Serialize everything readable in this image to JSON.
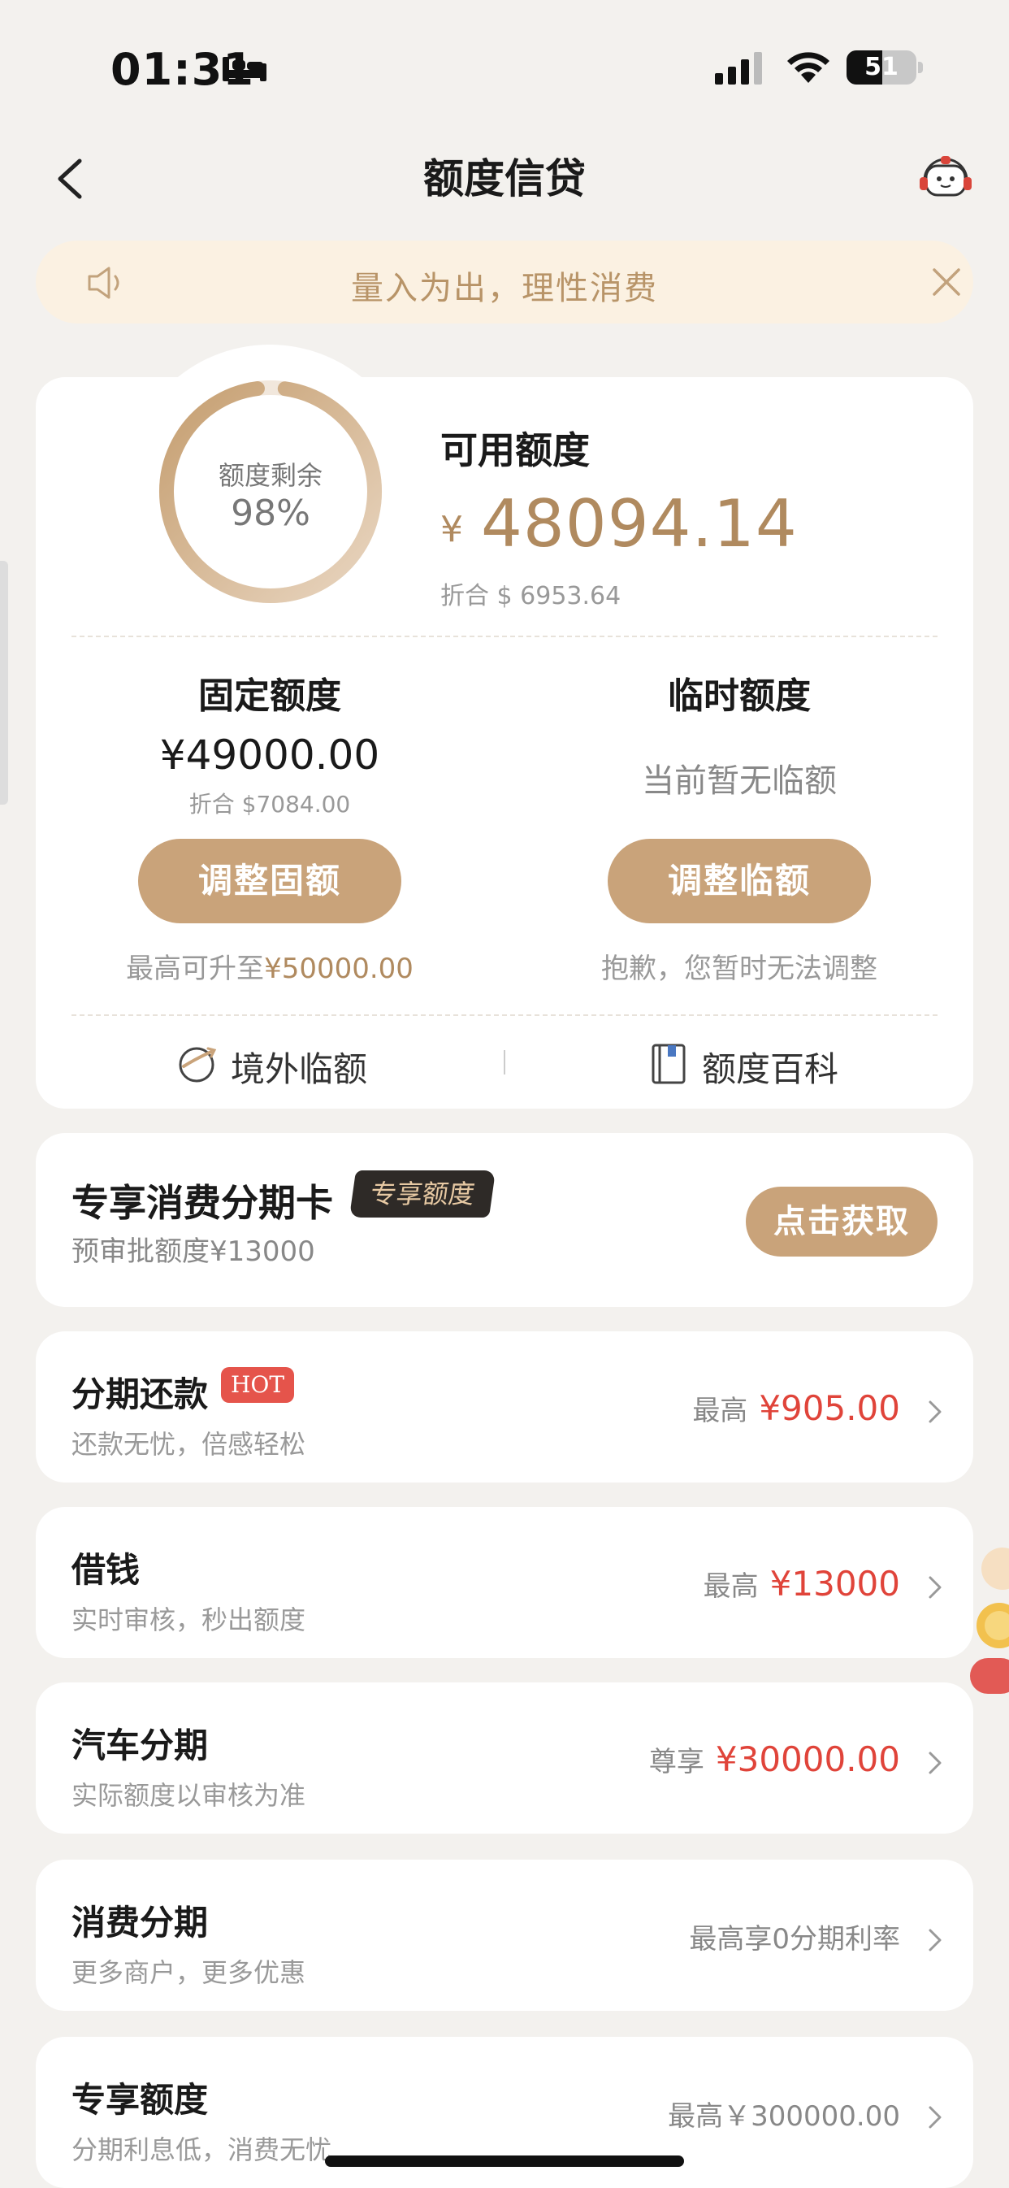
{
  "status_bar": {
    "time": "01:31",
    "battery": "51",
    "battery_level": 0.51
  },
  "nav": {
    "title": "额度信贷"
  },
  "notice": {
    "text": "量入为出，理性消费"
  },
  "credit": {
    "ring_label": "额度剩余",
    "ring_value": "98%",
    "ring_fraction": 0.98,
    "available_label": "可用额度",
    "currency_symbol": "¥",
    "available_amount": "48094.14",
    "available_converted": "折合 $ 6953.64",
    "fixed": {
      "title": "固定额度",
      "amount": "¥49000.00",
      "converted": "折合 $7084.00",
      "button": "调整固额",
      "note_prefix": "最高可升至",
      "note_value": "¥50000.00"
    },
    "temporary": {
      "title": "临时额度",
      "status": "当前暂无临额",
      "button": "调整临额",
      "note": "抱歉，您暂时无法调整"
    },
    "links": {
      "overseas": "境外临额",
      "wiki": "额度百科"
    }
  },
  "exclusive_card": {
    "title": "专享消费分期卡",
    "badge": "专享额度",
    "subtitle": "预审批额度¥13000",
    "button": "点击获取"
  },
  "items": [
    {
      "title": "分期还款",
      "badge": "HOT",
      "subtitle": "还款无忧，倍感轻松",
      "prefix": "最高",
      "amount": "¥905.00"
    },
    {
      "title": "借钱",
      "subtitle": "实时审核，秒出额度",
      "prefix": "最高",
      "amount": "¥13000"
    },
    {
      "title": "汽车分期",
      "subtitle": "实际额度以审核为准",
      "prefix": "尊享",
      "amount": "¥30000.00"
    },
    {
      "title": "消费分期",
      "subtitle": "更多商户，更多优惠",
      "plain": "最高享0分期利率"
    },
    {
      "title": "专享额度",
      "subtitle": "分期利息低，消费无忧",
      "plain": "最高￥300000.00"
    }
  ],
  "colors": {
    "accent": "#c9a37a",
    "accent_text": "#b08a5f",
    "amount_red": "#e0443a",
    "background": "#f3f1ee"
  }
}
